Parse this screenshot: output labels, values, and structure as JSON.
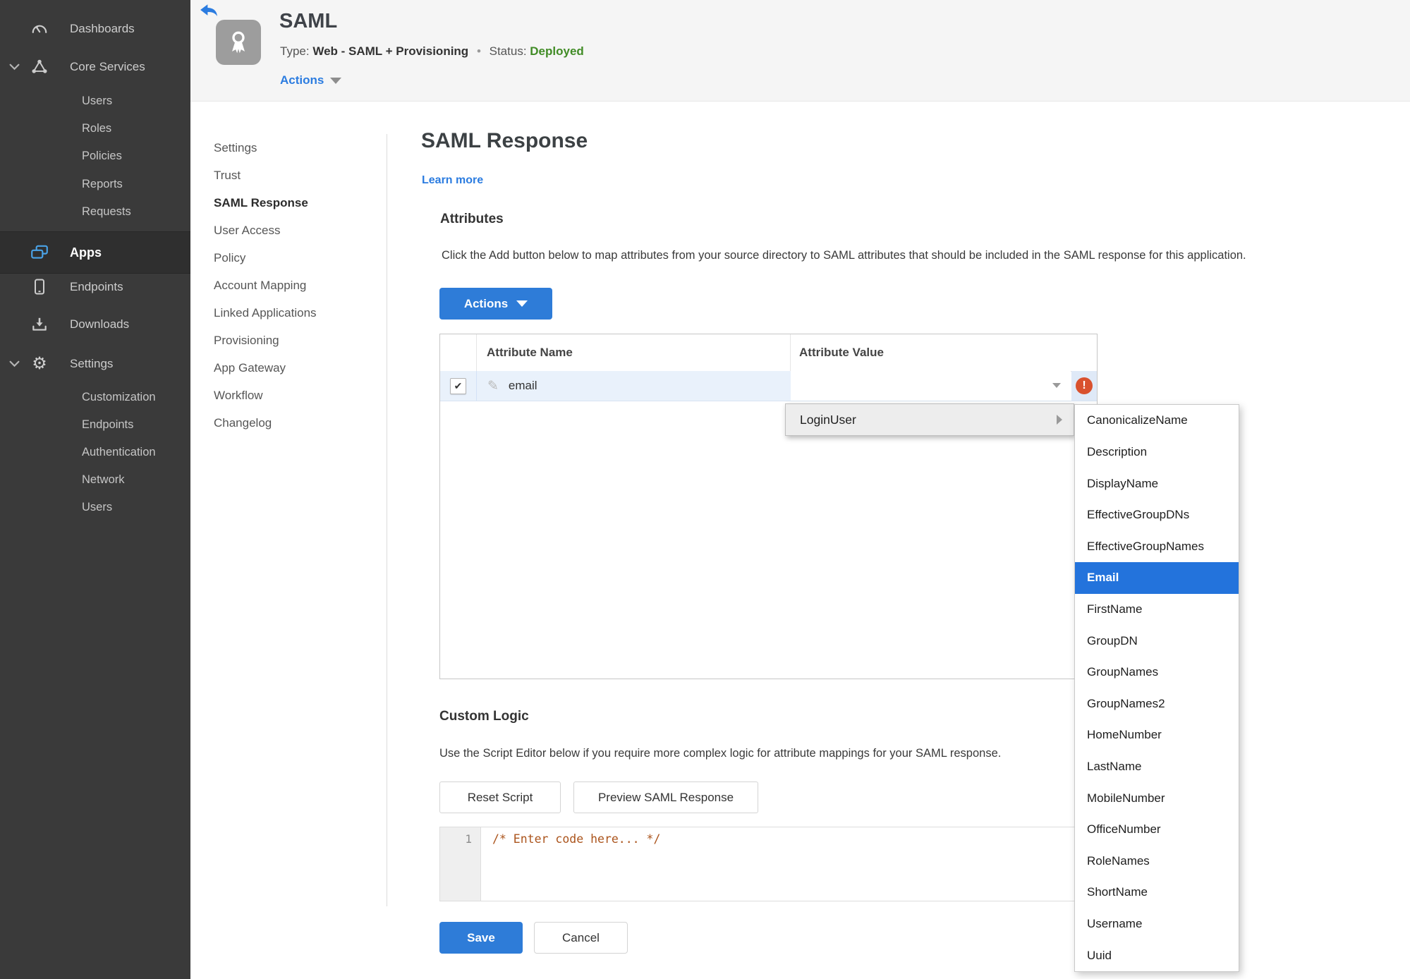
{
  "colors": {
    "accent_blue": "#2e7cd8",
    "link_blue": "#2b7ce0",
    "status_green": "#418c26",
    "error_red": "#d9512e",
    "selected_blue": "#2373dc",
    "row_highlight": "#e9f1fb",
    "sidebar_bg": "#3a3a3a"
  },
  "icons": {
    "check_glyph": "✔",
    "pencil_glyph": "✎",
    "gear_glyph": "⚙",
    "error_glyph": "!"
  },
  "sidebar": {
    "dashboards": "Dashboards",
    "core_services": "Core Services",
    "core_children": [
      "Users",
      "Roles",
      "Policies",
      "Reports",
      "Requests"
    ],
    "apps": "Apps",
    "endpoints": "Endpoints",
    "downloads": "Downloads",
    "settings": "Settings",
    "settings_children": [
      "Customization",
      "Endpoints",
      "Authentication",
      "Network",
      "Users"
    ]
  },
  "header": {
    "title": "SAML",
    "type_label": "Type:",
    "type_value": "Web - SAML + Provisioning",
    "separator": "•",
    "status_label": "Status:",
    "status_value": "Deployed",
    "actions_label": "Actions"
  },
  "subnav": {
    "items": [
      "Settings",
      "Trust",
      "SAML Response",
      "User Access",
      "Policy",
      "Account Mapping",
      "Linked Applications",
      "Provisioning",
      "App Gateway",
      "Workflow",
      "Changelog"
    ],
    "active": "SAML Response"
  },
  "main": {
    "title": "SAML Response",
    "learn_more": "Learn more",
    "attributes": {
      "heading": "Attributes",
      "description": "Click the Add button below to map attributes from your source directory to SAML attributes that should be included in the SAML response for this application.",
      "actions_button": "Actions",
      "table": {
        "col_name": "Attribute Name",
        "col_value": "Attribute Value",
        "row": {
          "name": "email",
          "value": "",
          "checked": true,
          "error": true
        }
      }
    },
    "value_menu": {
      "root": "LoginUser",
      "selected": "Email",
      "options": [
        "CanonicalizeName",
        "Description",
        "DisplayName",
        "EffectiveGroupDNs",
        "EffectiveGroupNames",
        "Email",
        "FirstName",
        "GroupDN",
        "GroupNames",
        "GroupNames2",
        "HomeNumber",
        "LastName",
        "MobileNumber",
        "OfficeNumber",
        "RoleNames",
        "ShortName",
        "Username",
        "Uuid"
      ]
    },
    "custom_logic": {
      "heading": "Custom Logic",
      "description": "Use the Script Editor below if you require more complex logic for attribute mappings for your SAML response.",
      "reset_button": "Reset Script",
      "preview_button": "Preview SAML Response",
      "editor": {
        "line_number": "1",
        "code": "/* Enter code here... */"
      }
    },
    "save_button": "Save",
    "cancel_button": "Cancel"
  }
}
